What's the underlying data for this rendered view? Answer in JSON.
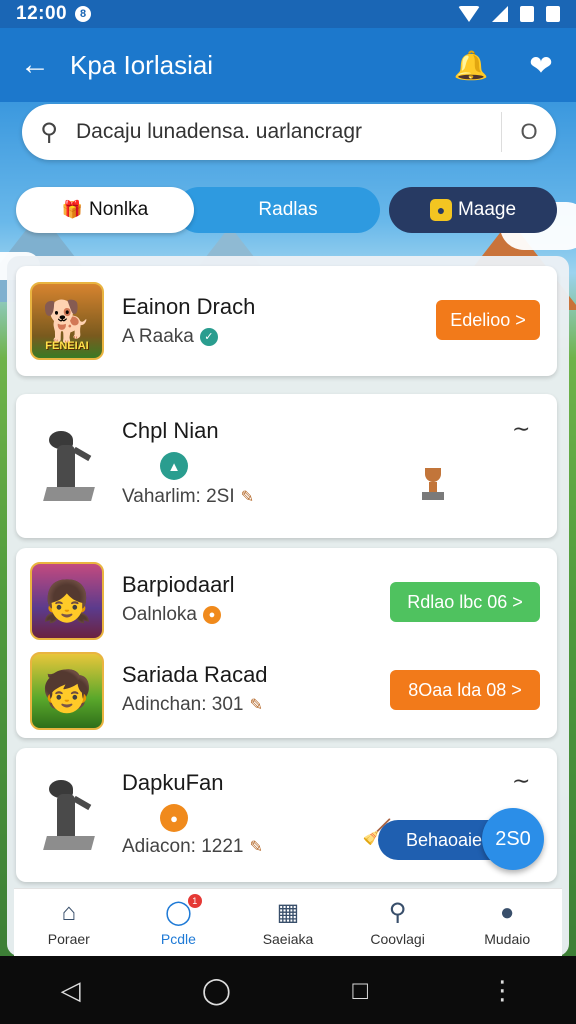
{
  "status_bar": {
    "time": "12:00",
    "notification_badge": "8"
  },
  "app_bar": {
    "title": "Kpa Iorlasiai"
  },
  "search": {
    "placeholder": "Dacaju lunadensa. uarlancragr",
    "right_glyph": "O"
  },
  "tabs": [
    {
      "label": "Nonlka",
      "active": true
    },
    {
      "label": "Radlas",
      "active": false
    },
    {
      "label": "Maage",
      "active": false
    }
  ],
  "cards": [
    {
      "title": "Eainon Drach",
      "subtitle": "A Raaka",
      "button": "Edelioo >",
      "thumb_caption": "FENEIAI"
    },
    {
      "title": "Chpl Nian",
      "subtitle": "Vaharlim: 2SI"
    },
    {
      "title": "Barpiodaarl",
      "subtitle": "Oalnloka",
      "button": "Rdlao lbc 06 >"
    },
    {
      "title": "Sariada Racad",
      "subtitle": "Adinchan: 301",
      "button": "8Oaa lda 08 >"
    },
    {
      "title": "DapkuFan",
      "subtitle": "Adiacon: 1221",
      "pill": "Behaoaie",
      "fab": "2S0"
    }
  ],
  "bottom_nav": [
    {
      "label": "Poraer",
      "icon": "home-icon"
    },
    {
      "label": "Pcdle",
      "icon": "globe-icon",
      "active": true,
      "badge": "1"
    },
    {
      "label": "Saeiaka",
      "icon": "grid-icon"
    },
    {
      "label": "Coovlagi",
      "icon": "search-icon"
    },
    {
      "label": "Mudaio",
      "icon": "profile-icon"
    }
  ]
}
